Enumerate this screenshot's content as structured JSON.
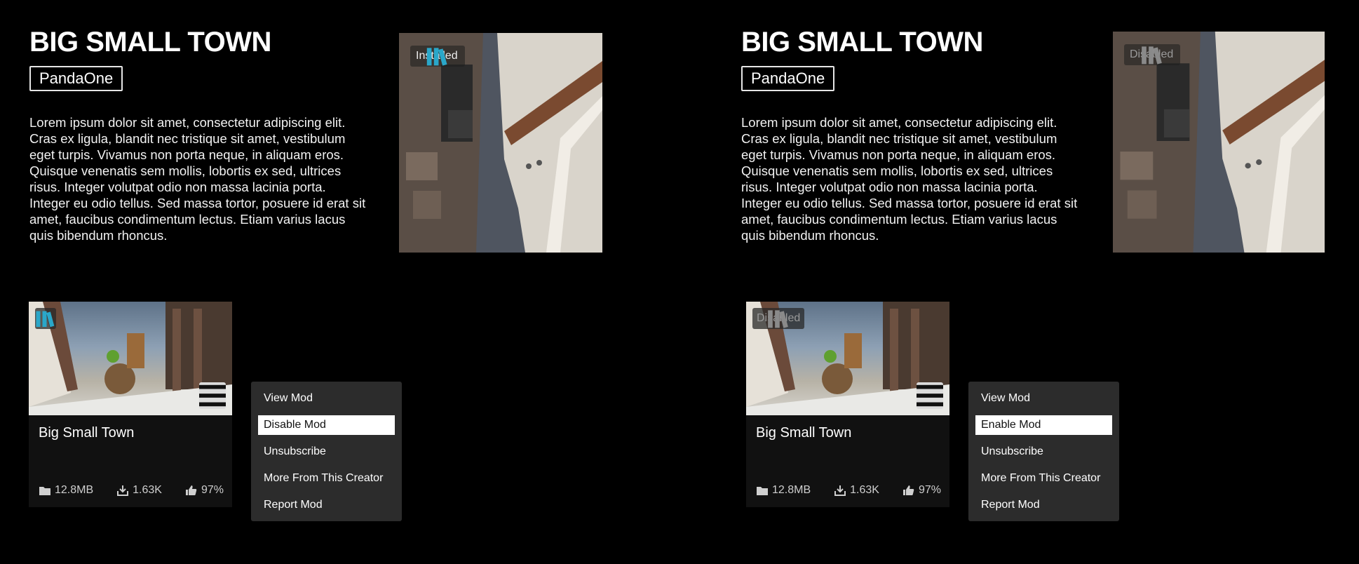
{
  "panels": [
    {
      "title": "BIG SMALL TOWN",
      "author": "PandaOne",
      "description": "Lorem ipsum dolor sit amet, consectetur adipiscing elit. Cras ex ligula, blandit nec tristique sit amet, vestibulum eget turpis. Vivamus non porta neque, in aliquam eros. Quisque venenatis sem mollis, lobortis ex sed, ultrices risus. Integer volutpat odio non massa lacinia porta. Integer eu odio tellus. Sed massa tortor, posuere id erat sit amet, faucibus condimentum lectus. Etiam varius lacus quis bibendum rhoncus.",
      "hero_status": "Installed",
      "hero_status_icon": "library-icon",
      "card": {
        "badge_label": "",
        "badge_icon": "library-icon",
        "name": "Big Small Town",
        "size": "12.8MB",
        "downloads": "1.63K",
        "rating": "97%"
      },
      "menu": [
        "View Mod",
        "Disable Mod",
        "Unsubscribe",
        "More From This Creator",
        "Report Mod"
      ],
      "menu_active_index": 1
    },
    {
      "title": "BIG SMALL TOWN",
      "author": "PandaOne",
      "description": "Lorem ipsum dolor sit amet, consectetur adipiscing elit. Cras ex ligula, blandit nec tristique sit amet, vestibulum eget turpis. Vivamus non porta neque, in aliquam eros. Quisque venenatis sem mollis, lobortis ex sed, ultrices risus. Integer volutpat odio non massa lacinia porta. Integer eu odio tellus. Sed massa tortor, posuere id erat sit amet, faucibus condimentum lectus. Etiam varius lacus quis bibendum rhoncus.",
      "hero_status": "Disabled",
      "hero_status_icon": "library-icon",
      "card": {
        "badge_label": "Disabled",
        "badge_icon": "library-icon",
        "name": "Big Small Town",
        "size": "12.8MB",
        "downloads": "1.63K",
        "rating": "97%"
      },
      "menu": [
        "View Mod",
        "Enable Mod",
        "Unsubscribe",
        "More From This Creator",
        "Report Mod"
      ],
      "menu_active_index": 1
    }
  ],
  "colors": {
    "installed_icon": "#2aa7c9",
    "disabled_icon": "#8a8a8a",
    "background": "#000000",
    "menu_bg": "#2c2c2c",
    "card_bg": "#111111"
  }
}
